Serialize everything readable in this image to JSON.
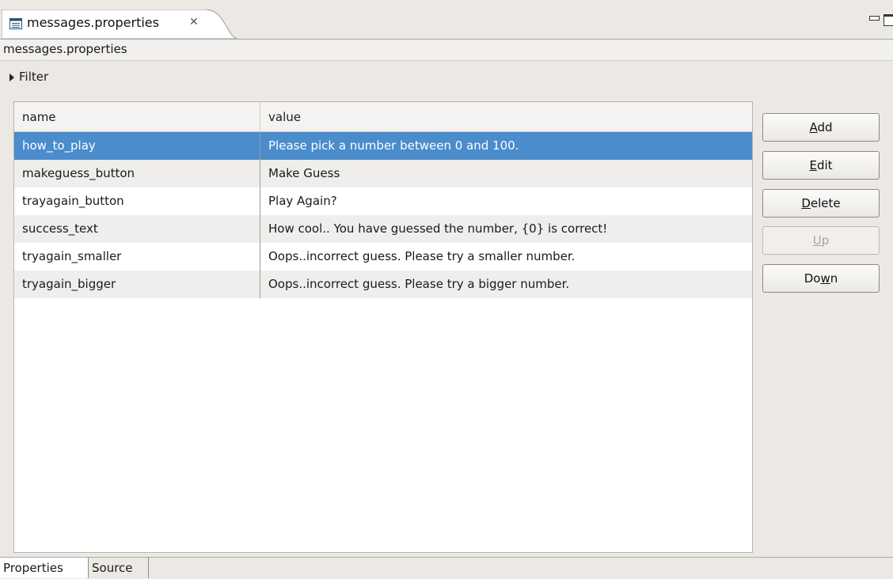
{
  "tab": {
    "title": "messages.properties",
    "close_symbol": "✕",
    "icon": "properties-file-icon"
  },
  "window_controls": {
    "minimize_icon": "minimize-icon",
    "maximize_icon": "maximize-icon"
  },
  "editor_title": "messages.properties",
  "filter": {
    "label": "Filter"
  },
  "table": {
    "columns": [
      "name",
      "value"
    ],
    "rows": [
      {
        "name": "how_to_play",
        "value": "Please pick a number between 0 and 100.",
        "selected": true
      },
      {
        "name": "makeguess_button",
        "value": "Make Guess"
      },
      {
        "name": "trayagain_button",
        "value": "Play Again?"
      },
      {
        "name": "success_text",
        "value": "How cool.. You have guessed the number, {0} is correct!"
      },
      {
        "name": "tryagain_smaller",
        "value": "Oops..incorrect guess. Please try a smaller number."
      },
      {
        "name": "tryagain_bigger",
        "value": "Oops..incorrect guess. Please try a bigger number."
      }
    ]
  },
  "buttons": {
    "add": {
      "mnemonic": "A",
      "rest": "dd"
    },
    "edit": {
      "mnemonic": "E",
      "rest": "dit"
    },
    "delete": {
      "mnemonic": "D",
      "rest": "elete"
    },
    "up": {
      "mnemonic": "U",
      "rest": "p",
      "enabled": false
    },
    "down": {
      "pre": "Do",
      "mnemonic": "w",
      "rest": "n"
    }
  },
  "bottom_tabs": [
    "Properties",
    "Source"
  ],
  "colors": {
    "selection": "#4a8ccc",
    "background": "#ece9e4"
  }
}
